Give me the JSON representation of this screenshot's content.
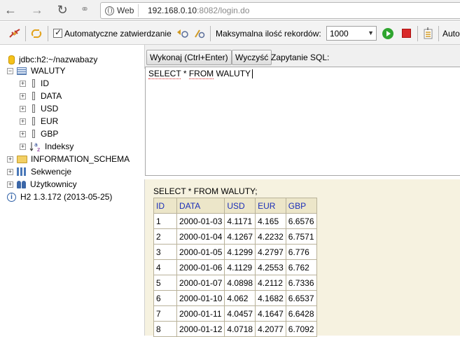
{
  "browser": {
    "web_label": "Web",
    "url_host": "192.168.0.10",
    "url_rest": ":8082/login.do"
  },
  "toolbar": {
    "auto_commit_label": "Automatyczne zatwierdzanie",
    "max_records_label": "Maksymalna ilość rekordów:",
    "max_records_value": "1000",
    "auto_label": "Auto"
  },
  "tree": {
    "connection": "jdbc:h2:~/nazwabazy",
    "table": "WALUTY",
    "columns": [
      "ID",
      "DATA",
      "USD",
      "EUR",
      "GBP"
    ],
    "indexes": "Indeksy",
    "schema": "INFORMATION_SCHEMA",
    "sequences": "Sekwencje",
    "users": "Użytkownicy",
    "version": "H2 1.3.172 (2013-05-25)"
  },
  "query": {
    "run_button": "Wykonaj (Ctrl+Enter)",
    "clear_button": "Wyczyść",
    "sql_label": "Zapytanie SQL:",
    "sql_words": [
      "SELECT",
      "*",
      "FROM",
      "WALUTY"
    ]
  },
  "results": {
    "title": "SELECT * FROM WALUTY;",
    "headers": [
      "ID",
      "DATA",
      "USD",
      "EUR",
      "GBP"
    ],
    "rows": [
      [
        "1",
        "2000-01-03",
        "4.1171",
        "4.165",
        "6.6576"
      ],
      [
        "2",
        "2000-01-04",
        "4.1267",
        "4.2232",
        "6.7571"
      ],
      [
        "3",
        "2000-01-05",
        "4.1299",
        "4.2797",
        "6.776"
      ],
      [
        "4",
        "2000-01-06",
        "4.1129",
        "4.2553",
        "6.762"
      ],
      [
        "5",
        "2000-01-07",
        "4.0898",
        "4.2112",
        "6.7336"
      ],
      [
        "6",
        "2000-01-10",
        "4.062",
        "4.1682",
        "6.6537"
      ],
      [
        "7",
        "2000-01-11",
        "4.0457",
        "4.1647",
        "6.6428"
      ],
      [
        "8",
        "2000-01-12",
        "4.0718",
        "4.2077",
        "6.7092"
      ]
    ]
  }
}
